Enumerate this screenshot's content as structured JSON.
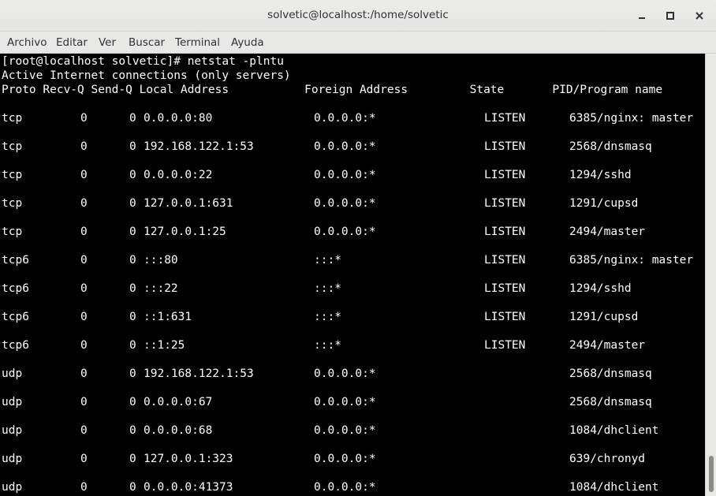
{
  "window": {
    "title": "solvetic@localhost:/home/solvetic"
  },
  "menubar": {
    "items": [
      "Archivo",
      "Editar",
      "Ver",
      "Buscar",
      "Terminal",
      "Ayuda"
    ]
  },
  "terminal": {
    "lines": [
      "[root@localhost solvetic]# netstat -plntu",
      "Active Internet connections (only servers)",
      "Proto Recv-Q Send-Q Local Address           Foreign Address         State       PID/Program name"
    ],
    "rows": [
      {
        "proto": "tcp",
        "recv": "0",
        "send": "0",
        "local": "0.0.0.0:80",
        "foreign": "0.0.0.0:*",
        "state": "LISTEN",
        "pid": "6385/nginx: master"
      },
      {
        "proto": "tcp",
        "recv": "0",
        "send": "0",
        "local": "192.168.122.1:53",
        "foreign": "0.0.0.0:*",
        "state": "LISTEN",
        "pid": "2568/dnsmasq"
      },
      {
        "proto": "tcp",
        "recv": "0",
        "send": "0",
        "local": "0.0.0.0:22",
        "foreign": "0.0.0.0:*",
        "state": "LISTEN",
        "pid": "1294/sshd"
      },
      {
        "proto": "tcp",
        "recv": "0",
        "send": "0",
        "local": "127.0.0.1:631",
        "foreign": "0.0.0.0:*",
        "state": "LISTEN",
        "pid": "1291/cupsd"
      },
      {
        "proto": "tcp",
        "recv": "0",
        "send": "0",
        "local": "127.0.0.1:25",
        "foreign": "0.0.0.0:*",
        "state": "LISTEN",
        "pid": "2494/master"
      },
      {
        "proto": "tcp6",
        "recv": "0",
        "send": "0",
        "local": ":::80",
        "foreign": ":::*",
        "state": "LISTEN",
        "pid": "6385/nginx: master"
      },
      {
        "proto": "tcp6",
        "recv": "0",
        "send": "0",
        "local": ":::22",
        "foreign": ":::*",
        "state": "LISTEN",
        "pid": "1294/sshd"
      },
      {
        "proto": "tcp6",
        "recv": "0",
        "send": "0",
        "local": "::1:631",
        "foreign": ":::*",
        "state": "LISTEN",
        "pid": "1291/cupsd"
      },
      {
        "proto": "tcp6",
        "recv": "0",
        "send": "0",
        "local": "::1:25",
        "foreign": ":::*",
        "state": "LISTEN",
        "pid": "2494/master"
      },
      {
        "proto": "udp",
        "recv": "0",
        "send": "0",
        "local": "192.168.122.1:53",
        "foreign": "0.0.0.0:*",
        "state": "",
        "pid": "2568/dnsmasq"
      },
      {
        "proto": "udp",
        "recv": "0",
        "send": "0",
        "local": "0.0.0.0:67",
        "foreign": "0.0.0.0:*",
        "state": "",
        "pid": "2568/dnsmasq"
      },
      {
        "proto": "udp",
        "recv": "0",
        "send": "0",
        "local": "0.0.0.0:68",
        "foreign": "0.0.0.0:*",
        "state": "",
        "pid": "1084/dhclient"
      },
      {
        "proto": "udp",
        "recv": "0",
        "send": "0",
        "local": "127.0.0.1:323",
        "foreign": "0.0.0.0:*",
        "state": "",
        "pid": "639/chronyd"
      },
      {
        "proto": "udp",
        "recv": "0",
        "send": "0",
        "local": "0.0.0.0:41373",
        "foreign": "0.0.0.0:*",
        "state": "",
        "pid": "1084/dhclient"
      }
    ]
  },
  "icons": {
    "minimize": "minimize-icon",
    "maximize": "maximize-icon",
    "close": "close-icon"
  },
  "colors": {
    "terminal_bg": "#000000",
    "terminal_fg": "#ffffff",
    "chrome_bg": "#e8e8e7"
  }
}
